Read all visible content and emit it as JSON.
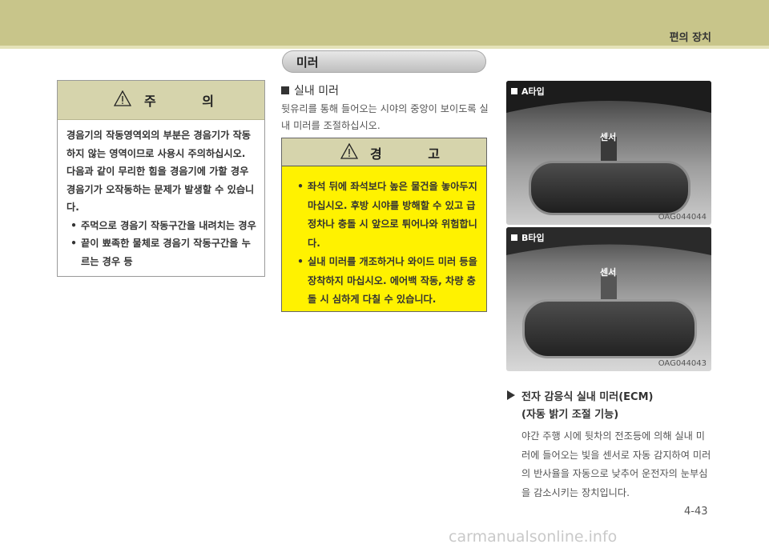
{
  "header": {
    "section_title": "편의 장치"
  },
  "section_pill": "미러",
  "caution": {
    "title": "주 의",
    "paragraphs": [
      "경음기의 작동영역외의 부분은 경음기가 작동하지 않는 영역이므로 사용시 주의하십시오.",
      "다음과 같이 무리한 힘을 경음기에 가할 경우 경음기가 오작동하는 문제가 발생할 수 있습니다."
    ],
    "bullets": [
      "주먹으로 경음기 작동구간을 내려치는 경우",
      "끝이 뾰족한 물체로 경음기 작동구간을 누르는 경우 등"
    ]
  },
  "indoor_mirror": {
    "heading": "실내 미러",
    "description": "뒷유리를 통해 들어오는 시야의 중앙이 보이도록 실내 미러를 조절하십시오."
  },
  "warning": {
    "title": "경 고",
    "bullets": [
      "좌석 뒤에 좌석보다 높은 물건을 놓아두지 마십시오. 후방 시야를 방해할 수 있고 급정차나 충돌 시 앞으로 튀어나와 위험합니다.",
      "실내 미러를 개조하거나 와이드 미러 등을 장착하지 마십시오. 에어백 작동, 차량 충돌 시 심하게 다칠 수 있습니다."
    ]
  },
  "photos": [
    {
      "tag": "A타입",
      "sensor_label": "센서",
      "code": "OAG044044"
    },
    {
      "tag": "B타입",
      "sensor_label": "센서",
      "code": "OAG044043"
    }
  ],
  "ecm": {
    "heading_line1": "전자 감응식 실내 미러(ECM)",
    "heading_line2": "(자동 밝기 조절 기능)",
    "body": "야간 주행 시에 뒷차의 전조등에 의해 실내 미러에 들어오는 빛을 센서로 자동 감지하여 미러의 반사율을 자동으로 낮추어 운전자의 눈부심을 감소시키는 장치입니다."
  },
  "page_number": "4-43",
  "watermark": "carmanualsonline.info"
}
